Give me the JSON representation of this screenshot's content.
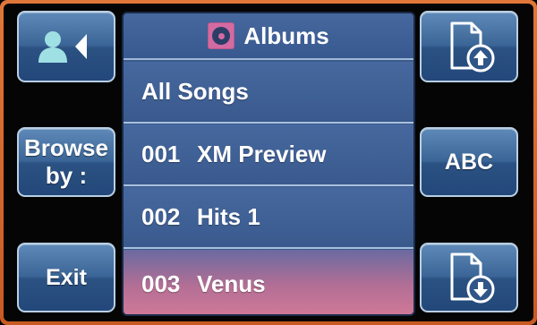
{
  "header": {
    "title": "Albums",
    "icon": "album-icon"
  },
  "left_buttons": {
    "contact_icon": "contact-back-icon",
    "browse_label": "Browse\nby :",
    "exit_label": "Exit"
  },
  "right_buttons": {
    "page_up_icon": "page-up-icon",
    "abc_label": "ABC",
    "page_down_icon": "page-down-icon"
  },
  "list": {
    "items": [
      {
        "number": "",
        "label": "All Songs"
      },
      {
        "number": "001",
        "label": "XM Preview"
      },
      {
        "number": "002",
        "label": "Hits 1"
      },
      {
        "number": "003",
        "label": "Venus"
      }
    ],
    "selected_index": 3
  },
  "colors": {
    "frame": "#d2662c",
    "button": "#3a6596",
    "panel": "#3c5a8c",
    "album_icon": "#d46aa2",
    "selected_row": "#c9789a"
  }
}
